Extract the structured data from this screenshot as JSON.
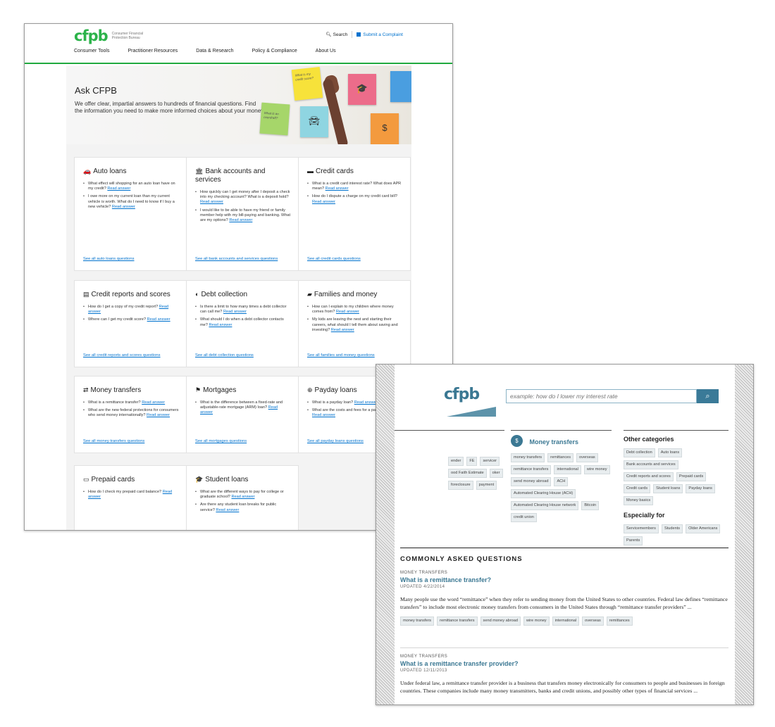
{
  "shot1": {
    "logo": {
      "mark": "cfpb",
      "text": "Consumer Financial Protection Bureau"
    },
    "utility": {
      "search": "Search",
      "complaint": "Submit a Complaint"
    },
    "nav": [
      "Consumer Tools",
      "Practitioner Resources",
      "Data & Research",
      "Policy & Compliance",
      "About Us"
    ],
    "hero": {
      "title": "Ask CFPB",
      "description": "We offer clear, impartial answers to hundreds of financial questions. Find the information you need to make more informed choices about your money.",
      "notes": [
        "What is my credit score?",
        "What is an overdraft?"
      ]
    },
    "cards": [
      {
        "icon": "🚗",
        "title": "Auto loans",
        "items": [
          {
            "text": "What effect will shopping for an auto loan have on my credit?",
            "link": "Read answer"
          },
          {
            "text": "I owe more on my current loan than my current vehicle is worth. What do I need to know if I buy a new vehicle?",
            "link": "Read answer"
          }
        ],
        "seeall": "See all auto loans questions"
      },
      {
        "icon": "🏛",
        "title": "Bank accounts and services",
        "items": [
          {
            "text": "How quickly can I get money after I deposit a check into my checking account? What is a deposit hold?",
            "link": "Read answer"
          },
          {
            "text": "I would like to be able to have my friend or family member help with my bill-paying and banking. What are my options?",
            "link": "Read answer"
          }
        ],
        "seeall": "See all bank accounts and services questions"
      },
      {
        "icon": "▬",
        "title": "Credit cards",
        "items": [
          {
            "text": "What is a credit card interest rate? What does APR mean?",
            "link": "Read answer"
          },
          {
            "text": "How do I dispute a charge on my credit card bill?",
            "link": "Read answer"
          }
        ],
        "seeall": "See all credit cards questions"
      },
      {
        "icon": "▤",
        "title": "Credit reports and scores",
        "items": [
          {
            "text": "How do I get a copy of my credit report?",
            "link": "Read answer"
          },
          {
            "text": "Where can I get my credit score?",
            "link": "Read answer"
          }
        ],
        "seeall": "See all credit reports and scores questions"
      },
      {
        "icon": "◐",
        "title": "Debt collection",
        "items": [
          {
            "text": "Is there a limit to how many times a debt collector can call me?",
            "link": "Read answer"
          },
          {
            "text": "What should I do when a debt collector contacts me?",
            "link": "Read answer"
          }
        ],
        "seeall": "See all debt collection questions"
      },
      {
        "icon": "▰",
        "title": "Families and money",
        "items": [
          {
            "text": "How can I explain to my children where money comes from?",
            "link": "Read answer"
          },
          {
            "text": "My kids are leaving the nest and starting their careers, what should I tell them about saving and investing?",
            "link": "Read answer"
          }
        ],
        "seeall": "See all families and money questions"
      },
      {
        "icon": "⇄",
        "title": "Money transfers",
        "items": [
          {
            "text": "What is a remittance transfer?",
            "link": "Read answer"
          },
          {
            "text": "What are the new federal protections for consumers who send money internationally?",
            "link": "Read answer"
          }
        ],
        "seeall": "See all money transfers questions"
      },
      {
        "icon": "⚑",
        "title": "Mortgages",
        "items": [
          {
            "text": "What is the difference between a fixed-rate and adjustable-rate mortgage (ARM) loan?",
            "link": "Read answer"
          }
        ],
        "seeall": "See all mortgages questions"
      },
      {
        "icon": "⊕",
        "title": "Payday loans",
        "items": [
          {
            "text": "What is a payday loan?",
            "link": "Read answer"
          },
          {
            "text": "What are the costs and fees for a payday loan?",
            "link": "Read answer"
          }
        ],
        "seeall": "See all payday loans questions"
      },
      {
        "icon": "▭",
        "title": "Prepaid cards",
        "items": [
          {
            "text": "How do I check my prepaid card balance?",
            "link": "Read answer"
          }
        ],
        "seeall": ""
      },
      {
        "icon": "🎓",
        "title": "Student loans",
        "items": [
          {
            "text": "What are the different ways to pay for college or graduate school?",
            "link": "Read answer"
          },
          {
            "text": "Are there any student loan breaks for public service?",
            "link": "Read answer"
          }
        ],
        "seeall": ""
      }
    ]
  },
  "shot2": {
    "logo": "cfpb",
    "search": {
      "placeholder": "example: how do I lower my interest rate"
    },
    "left_tags": [
      "ender",
      "FE",
      "servicer",
      "ood Faith Estimate",
      "oker",
      "foreclosure",
      "payment"
    ],
    "money_transfers": {
      "title": "Money transfers",
      "tags": [
        "money transfers",
        "remittances",
        "overseas",
        "remittance transfers",
        "international",
        "wire money",
        "send money abroad",
        "ACH",
        "Automated Clearing House (ACH)",
        "Automated Clearing House network",
        "Bitcoin",
        "credit union"
      ]
    },
    "other_categories": {
      "title": "Other categories",
      "tags": [
        "Debt collection",
        "Auto loans",
        "Bank accounts and services",
        "Credit reports and scores",
        "Prepaid cards",
        "Credit cards",
        "Student loans",
        "Payday loans",
        "Money basics"
      ]
    },
    "especially_for": {
      "title": "Especially for",
      "tags": [
        "Servicemembers",
        "Students",
        "Older Americans",
        "Parents"
      ]
    },
    "faq_heading": "COMMONLY ASKED QUESTIONS",
    "faqs": [
      {
        "category": "MONEY TRANSFERS",
        "question": "What is a remittance transfer?",
        "updated": "UPDATED 4/22/2014",
        "body": "Many people use the word “remittance” when they refer to sending money from the United States to other countries. Federal law defines “remittance transfers” to include most electronic money transfers from consumers in the United States through “remittance transfer providers” ...",
        "tags": [
          "money transfers",
          "remittance transfers",
          "send money abroad",
          "wire money",
          "international",
          "overseas",
          "remittances"
        ]
      },
      {
        "category": "MONEY TRANSFERS",
        "question": "What is a remittance transfer provider?",
        "updated": "UPDATED 12/11/2013",
        "body": "Under federal law, a remittance transfer provider is a business that transfers money electronically for consumers to people and businesses in foreign countries. These companies include many money transmitters, banks and credit unions, and possibly other types of financial services ...",
        "tags": []
      }
    ]
  }
}
